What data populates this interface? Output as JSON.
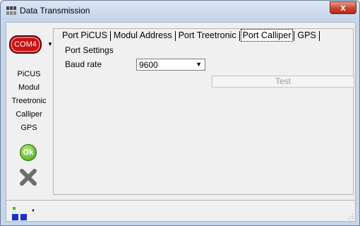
{
  "window": {
    "title": "Data Transmission",
    "close_label": "x"
  },
  "port_button": {
    "label": "COM4",
    "menu_arrow": "▼"
  },
  "nav_items": [
    "PiCUS",
    "Modul",
    "Treetronic",
    "Calliper",
    "GPS"
  ],
  "ok_button": {
    "label": "Ok"
  },
  "tabs": [
    "Port PiCUS",
    "Modul Address",
    "Port Treetronic",
    "Port Calliper",
    "GPS"
  ],
  "active_tab": "Port Calliper",
  "settings": {
    "section_title": "Port Settings",
    "baud_label": "Baud rate",
    "baud_value": "9600",
    "test_label": "Test"
  },
  "colors": {
    "com_red": "#c91212",
    "ok_green": "#3f9d12",
    "status_green": "#2ecc2e"
  }
}
